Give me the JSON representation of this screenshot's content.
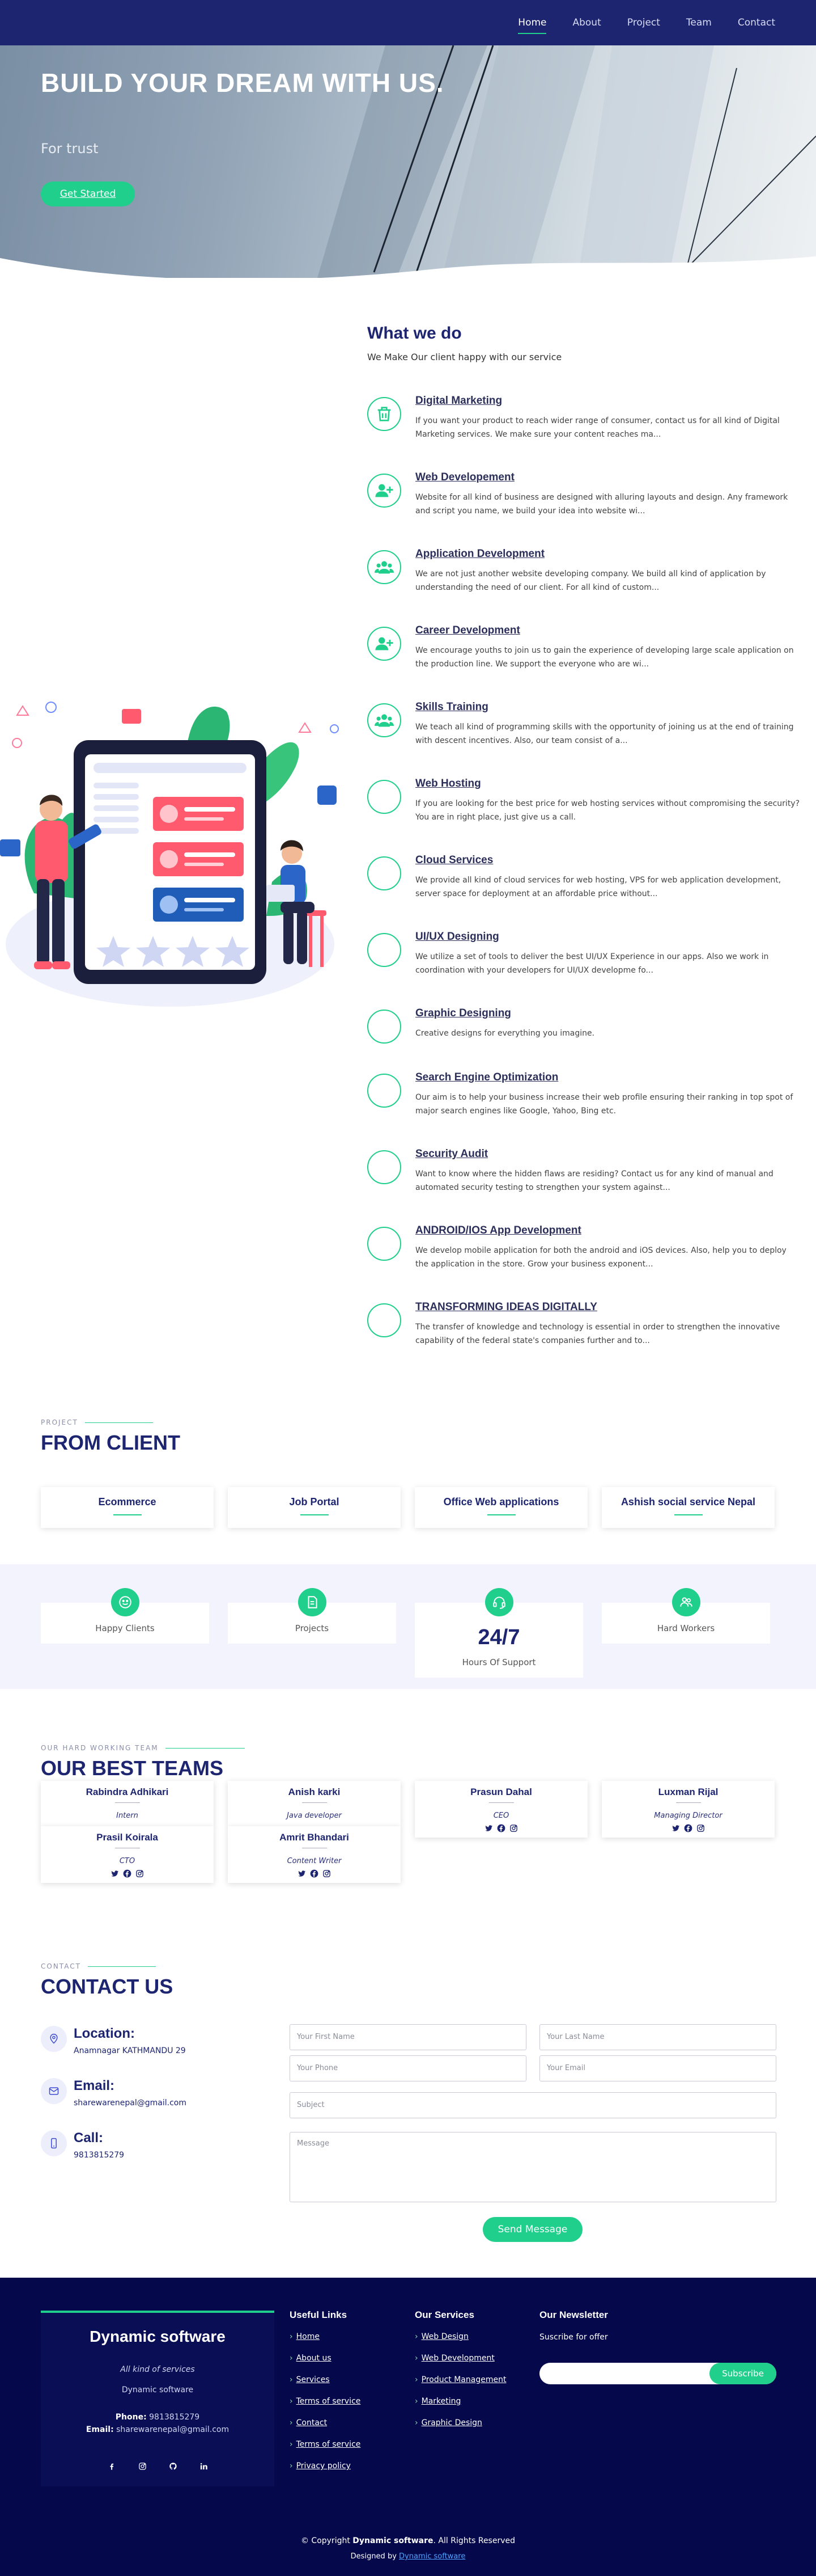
{
  "nav": {
    "items": [
      "Home",
      "About",
      "Project",
      "Team",
      "Contact"
    ],
    "active": "Home"
  },
  "hero": {
    "title": "BUILD YOUR DREAM WITH US.",
    "subtitle": "For trust",
    "cta": "Get Started"
  },
  "what_we_do": {
    "title": "What we do",
    "subtitle": "We Make Our client happy with our service",
    "services": [
      {
        "icon": "trash-icon",
        "title": "Digital Marketing",
        "text": "If you want your product to reach wider range of consumer, contact us for all kind of Digital Marketing services. We make sure your content reaches ma..."
      },
      {
        "icon": "user-plus-icon",
        "title": "Web Developement",
        "text": "Website for all kind of business are designed with alluring layouts and design. Any framework and script you name, we build your idea into website wi..."
      },
      {
        "icon": "users-icon",
        "title": "Application Development",
        "text": "We are not just another website developing company. We build all kind of application by understanding the need of our client. For all kind of custom..."
      },
      {
        "icon": "user-plus-icon",
        "title": "Career Development",
        "text": "We encourage youths to join us to gain the experience of developing large scale application on the production line. We support the everyone who are wi..."
      },
      {
        "icon": "users-icon",
        "title": "Skills Training",
        "text": "We teach all kind of programming skills with the opportunity of joining us at the end of training with descent incentives. Also, our team consist of a..."
      },
      {
        "icon": "",
        "title": "Web Hosting",
        "text": "If you are looking for the best price for web hosting services without compromising the security? You are in right place, just give us a call."
      },
      {
        "icon": "",
        "title": "Cloud Services",
        "text": "We provide all kind of cloud services for web hosting, VPS for web application development, server space for deployment at an affordable price without..."
      },
      {
        "icon": "",
        "title": "UI/UX Designing",
        "text": "We utilize a set of tools to deliver the best UI/UX Experience in our apps. Also we work in coordination with your developers for UI/UX developme fo..."
      },
      {
        "icon": "",
        "title": "Graphic Designing",
        "text": "Creative designs for everything you imagine."
      },
      {
        "icon": "",
        "title": "Search Engine Optimization",
        "text": "Our aim is to help your business increase their web profile ensuring their ranking in top spot of major search engines like Google, Yahoo, Bing etc."
      },
      {
        "icon": "",
        "title": "Security Audit",
        "text": "Want to know where the hidden flaws are residing? Contact us for any kind of manual and automated security testing to strengthen your system against..."
      },
      {
        "icon": "",
        "title": "ANDROID/IOS App Development",
        "text": "We develop mobile application for both the android and iOS devices. Also, help you to deploy the application in the store. Grow your business exponent..."
      },
      {
        "icon": "",
        "title": "TRANSFORMING IDEAS DIGITALLY",
        "text": "The transfer of knowledge and technology is essential in order to strengthen the innovative capability of the federal state's companies further and to..."
      }
    ]
  },
  "projects": {
    "kicker": "PROJECT",
    "title": "FROM CLIENT",
    "items": [
      "Ecommerce",
      "Job Portal",
      "Office Web applications",
      "Ashish social service Nepal"
    ]
  },
  "stats": {
    "items": [
      {
        "icon": "smile-icon",
        "label": "Happy Clients",
        "value": ""
      },
      {
        "icon": "document-icon",
        "label": "Projects",
        "value": ""
      },
      {
        "icon": "headset-icon",
        "label": "Hours Of Support",
        "value": "24/7"
      },
      {
        "icon": "users-icon",
        "label": "Hard Workers",
        "value": ""
      }
    ]
  },
  "team": {
    "kicker": "OUR HARD WORKING TEAM",
    "title": "OUR BEST TEAMS",
    "members": [
      {
        "name": "Rabindra Adhikari",
        "role": "Intern"
      },
      {
        "name": "Anish karki",
        "role": "Java developer"
      },
      {
        "name": "Prasun Dahal",
        "role": "CEO"
      },
      {
        "name": "Luxman Rijal",
        "role": "Managing Director"
      },
      {
        "name": "Prasil Koirala",
        "role": "CTO"
      },
      {
        "name": "Amrit Bhandari",
        "role": "Content Writer"
      }
    ]
  },
  "contact": {
    "kicker": "CONTACT",
    "title": "CONTACT US",
    "info": [
      {
        "icon": "location-pin-icon",
        "title": "Location:",
        "value": "Anamnagar KATHMANDU 29"
      },
      {
        "icon": "envelope-icon",
        "title": "Email:",
        "value": "sharewarenepal@gmail.com"
      },
      {
        "icon": "phone-icon",
        "title": "Call:",
        "value": "9813815279"
      }
    ],
    "form": {
      "first_name": "Your First Name",
      "last_name": "Your Last Name",
      "phone": "Your Phone",
      "email": "Your Email",
      "subject": "Subject",
      "message": "Message",
      "send": "Send Message"
    }
  },
  "footer": {
    "brand": "Dynamic software",
    "tagline": "All kind of services",
    "company": "Dynamic software",
    "phone_label": "Phone:",
    "phone": "9813815279",
    "email_label": "Email:",
    "email": "sharewarenepal@gmail.com",
    "useful_links": {
      "title": "Useful Links",
      "items": [
        "Home",
        "About us",
        "Services",
        "Terms of service",
        "Contact",
        "Terms of service",
        "Privacy policy"
      ]
    },
    "our_services": {
      "title": "Our Services",
      "items": [
        "Web Design",
        "Web Development",
        "Product Management",
        "Marketing",
        "Graphic Design"
      ]
    },
    "newsletter": {
      "title": "Our Newsletter",
      "text": "Suscribe for offer",
      "button": "Subscribe"
    },
    "copyright_pre": "© Copyright ",
    "copyright_brand": "Dynamic software",
    "copyright_post": ". All Rights Reserved",
    "designed_by": "Designed by ",
    "designer": "Dynamic software"
  },
  "colors": {
    "navy": "#1d2570",
    "accent": "#1fcf8b",
    "footer_bg": "#05084a"
  }
}
